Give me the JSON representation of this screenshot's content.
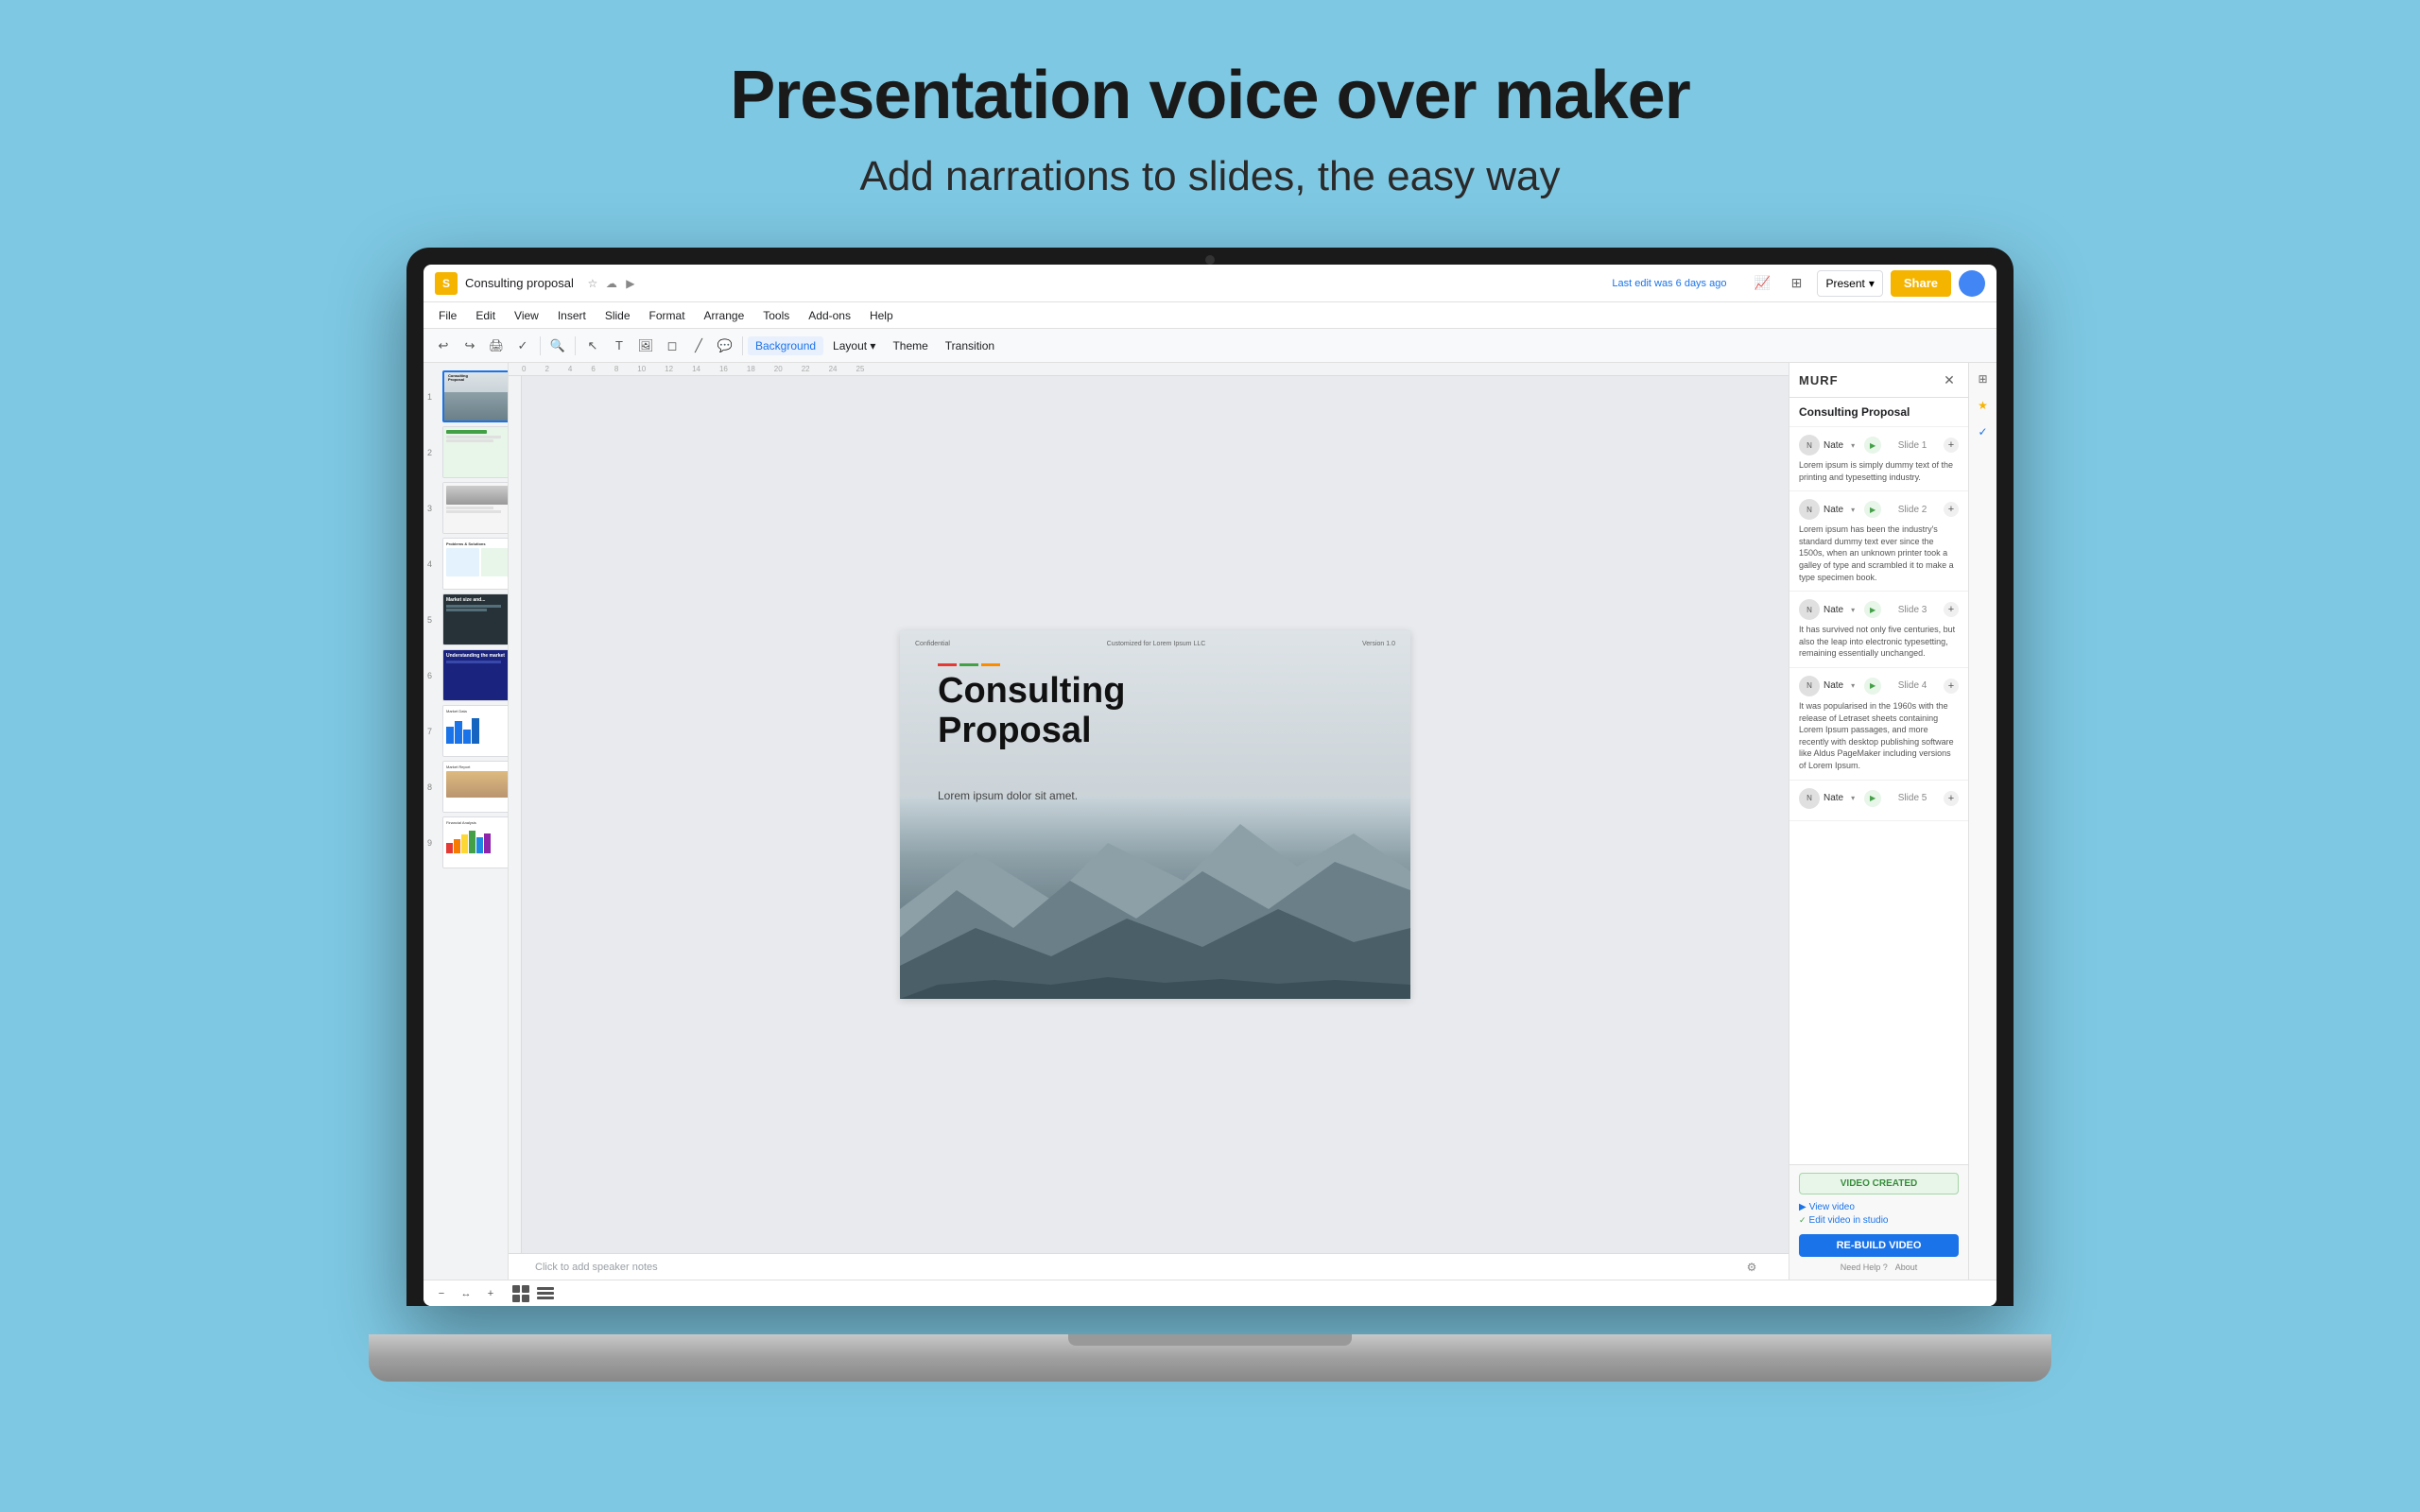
{
  "page": {
    "title": "Presentation voice over maker",
    "subtitle": "Add narrations to slides, the easy way",
    "bg_color": "#7ec8e3"
  },
  "slides_app": {
    "doc_title": "Consulting proposal",
    "last_edit": "Last edit was 6 days ago",
    "menu_items": [
      "File",
      "Edit",
      "View",
      "Insert",
      "Slide",
      "Format",
      "Arrange",
      "Tools",
      "Add-ons",
      "Help"
    ],
    "toolbar_items": [
      "Background",
      "Layout",
      "Theme",
      "Transition"
    ],
    "present_label": "Present",
    "share_label": "Share",
    "slide_title": "Consulting\nProposal",
    "slide_subtitle": "Lorem ipsum dolor sit amet.",
    "slide_confidential": "Confidential",
    "slide_customized": "Customized for Lorem Ipsum LLC",
    "slide_version": "Version 1.0",
    "speaker_notes": "Click to add speaker notes"
  },
  "murf": {
    "logo": "MURF",
    "panel_title": "Consulting Proposal",
    "slides": [
      {
        "voice": "Nate",
        "slide_num": "Slide 1",
        "text": "Lorem ipsum is simply dummy text of the printing and typesetting industry."
      },
      {
        "voice": "Nate",
        "slide_num": "Slide 2",
        "text": "Lorem ipsum has been the industry's standard dummy text ever since the 1500s, when an unknown printer took a galley of type and scrambled it to make a type specimen book."
      },
      {
        "voice": "Nate",
        "slide_num": "Slide 3",
        "text": "It has survived not only five centuries, but also the leap into electronic typesetting, remaining essentially unchanged."
      },
      {
        "voice": "Nate",
        "slide_num": "Slide 4",
        "text": "It was popularised in the 1960s with the release of Letraset sheets containing Lorem Ipsum passages, and more recently with desktop publishing software like Aldus PageMaker including versions of Lorem Ipsum."
      },
      {
        "voice": "Nate",
        "slide_num": "Slide 5",
        "text": ""
      }
    ],
    "video_created_label": "VIDEO CREATED",
    "view_video_label": "View video",
    "edit_video_label": "Edit video in studio",
    "rebuild_label": "RE-BUILD VIDEO",
    "need_help": "Need Help ?",
    "about": "About"
  }
}
